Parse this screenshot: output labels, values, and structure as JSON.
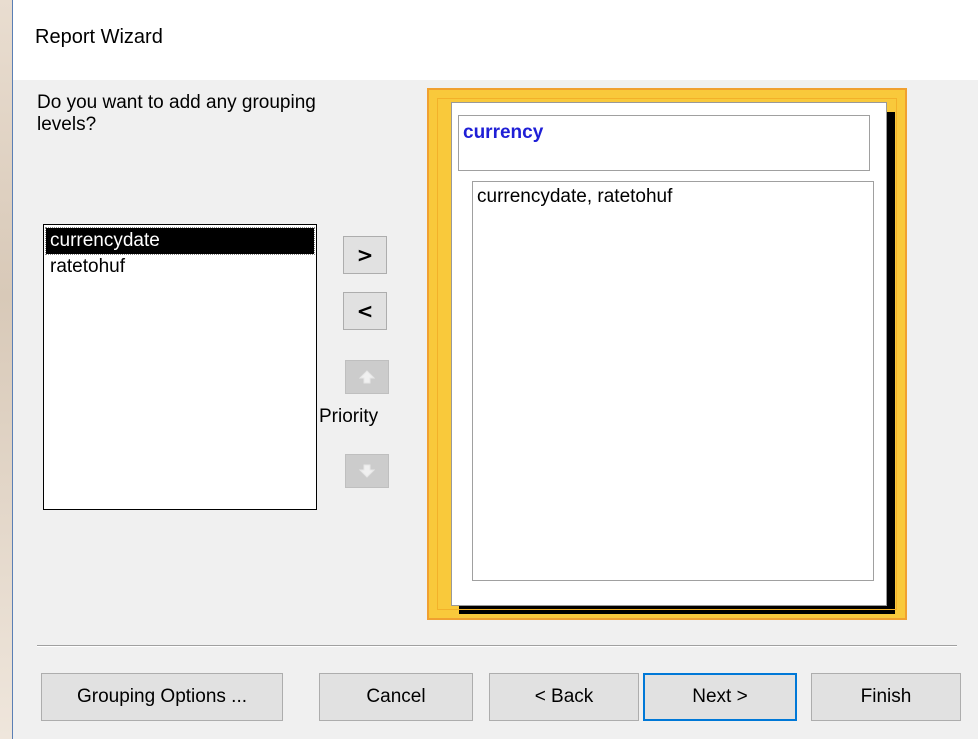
{
  "window": {
    "title": "Report Wizard"
  },
  "prompt": "Do you want to add any grouping levels?",
  "available_fields": [
    {
      "label": "currencydate",
      "selected": true
    },
    {
      "label": "ratetohuf",
      "selected": false
    }
  ],
  "move_buttons": {
    "add_label": ">",
    "remove_label": "<"
  },
  "priority": {
    "label": "Priority",
    "up_icon": "arrow-up-icon",
    "down_icon": "arrow-down-icon"
  },
  "preview": {
    "group_title": "currency",
    "detail_fields": "currencydate, ratetohuf"
  },
  "buttons": {
    "grouping_options": "Grouping Options ...",
    "cancel": "Cancel",
    "back": "< Back",
    "next": "Next >",
    "finish": "Finish"
  },
  "colors": {
    "preview_frame": "#f9c93b",
    "group_title_text": "#1f1fd6",
    "default_button_border": "#0078d7"
  }
}
